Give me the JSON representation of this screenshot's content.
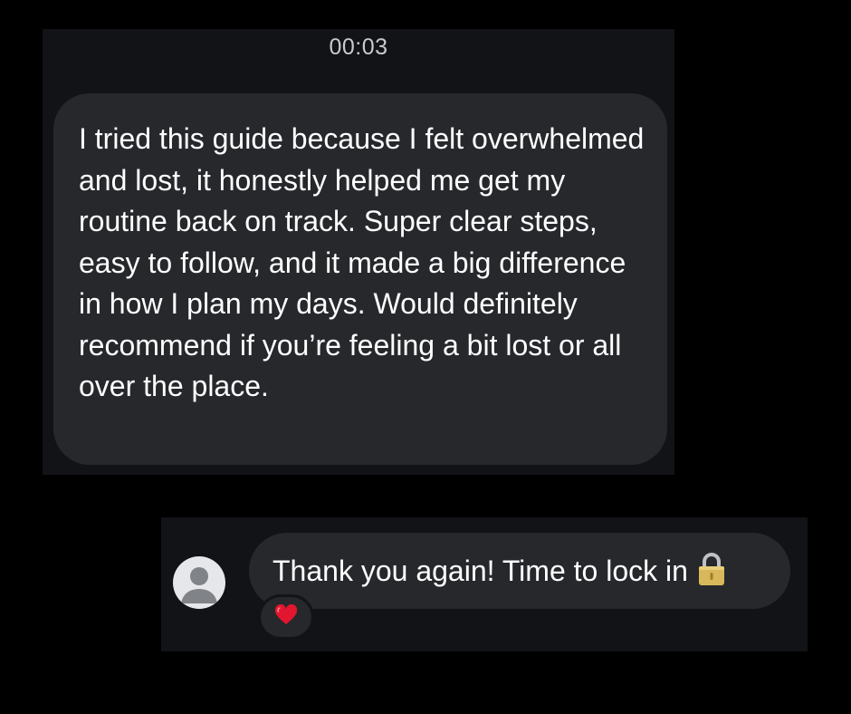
{
  "conversation": {
    "timestamp": "00:03",
    "received_message": {
      "text": "I tried this guide because I felt overwhelmed and lost, it honestly helped me get my routine back on track. Super clear steps, easy to follow, and it made a big difference in how I plan my days. Would definitely recommend if you’re feeling a bit lost or all over the place."
    },
    "sent_message": {
      "text": "Thank you again! Time to lock in",
      "emoji_icon": "lock-icon",
      "reaction_icon": "heart-icon"
    },
    "avatar_icon": "default-user-avatar-icon"
  },
  "colors": {
    "background": "#000000",
    "panel": "#111316",
    "bubble": "#26282c",
    "text": "#ffffff",
    "timestamp": "#c9cacc",
    "heart": "#e2162f",
    "lock": "#d8b85a"
  }
}
